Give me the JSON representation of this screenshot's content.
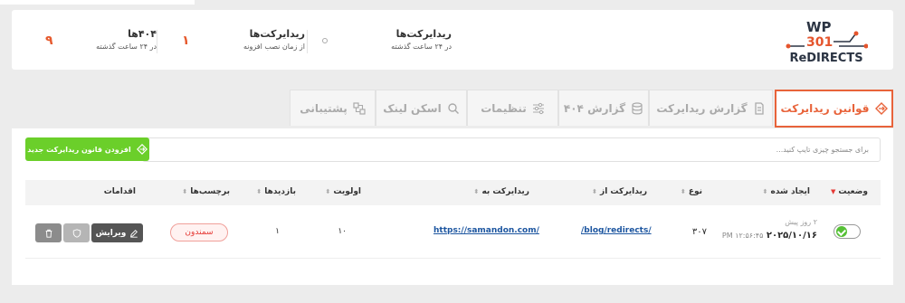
{
  "brand": {
    "line1": "WP",
    "line2": "301",
    "line3": "ReDIRECTS",
    "color_dark": "#2b3443",
    "color_accent": "#e5552d"
  },
  "stats": {
    "redirects_total": {
      "title": "ریدایرکت‌ها",
      "subtitle": "در ۲۴ ساعت گذشته"
    },
    "redirects_since": {
      "title": "ریدایرکت‌ها",
      "subtitle": "از زمان نصب افزونه",
      "value": "۱"
    },
    "errors_404": {
      "title": "۴۰۴ها",
      "subtitle": "در ۲۴ ساعت گذشته",
      "value": "۹"
    }
  },
  "tabs": [
    {
      "label": "قوانین ریدایرکت",
      "icon": "redirect-diamond-icon",
      "active": true
    },
    {
      "label": "گزارش ریدایرکت",
      "icon": "document-icon"
    },
    {
      "label": "گزارش ۴۰۴",
      "icon": "database-icon"
    },
    {
      "label": "تنظیمات",
      "icon": "sliders-icon"
    },
    {
      "label": "اسکن لینک",
      "icon": "search-icon"
    },
    {
      "label": "پشتیبانی",
      "icon": "support-icon"
    }
  ],
  "toolbar": {
    "search_placeholder": "برای جستجو چیزی تایپ کنید...",
    "add_label": "افزودن قانون ریدایرکت جدید"
  },
  "table": {
    "headers": [
      "وضعیت",
      "ایجاد شده",
      "نوع",
      "ریدایرکت از",
      "ریدایرکت به",
      "اولویت",
      "بازدیدها",
      "برچسب‌ها",
      "اقدامات"
    ],
    "rows": [
      {
        "status": "on",
        "created_ago": "۲ روز پیش",
        "created_date": "۲۰۲۵/۱۰/۱۶",
        "created_time": "۱۲:۵۶:۴۵ PM",
        "type": "۳۰۷",
        "from": "/blog/redirects/",
        "to": "https://samandon.com/",
        "priority": "۱۰",
        "hits": "۱",
        "tag": "سمندون",
        "edit_label": "ویرایش"
      }
    ]
  },
  "colors": {
    "accent": "#e8633a",
    "green": "#6bcf2a",
    "link": "#1d56a0",
    "tag_red": "#e53935"
  }
}
